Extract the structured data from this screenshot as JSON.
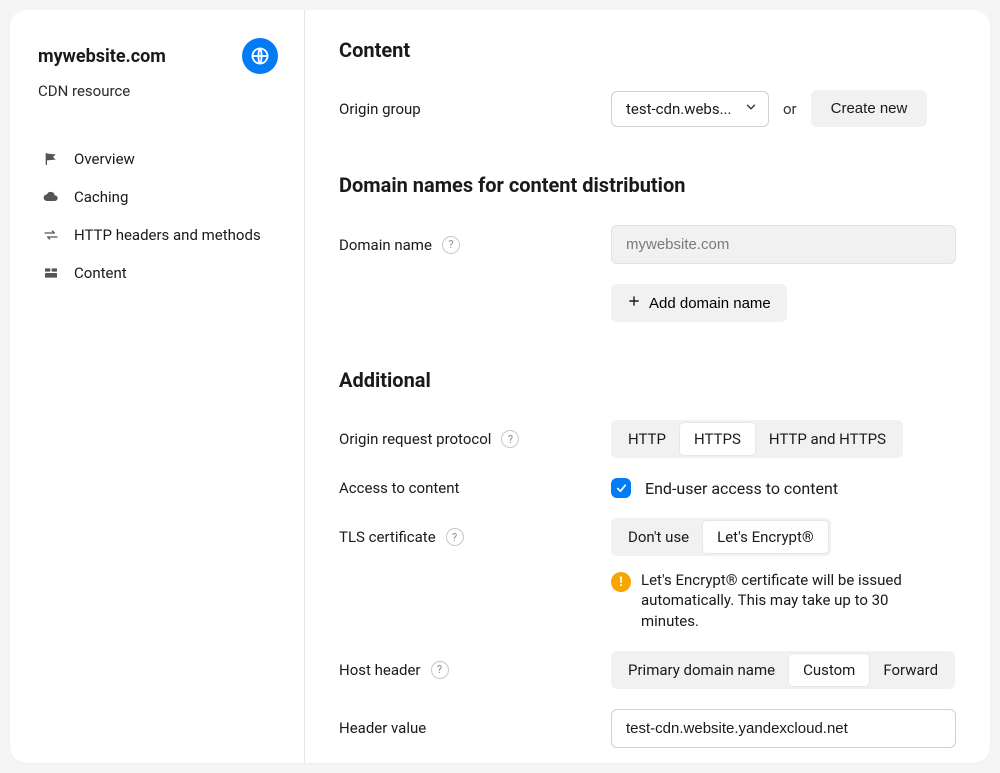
{
  "sidebar": {
    "title": "mywebsite.com",
    "subtitle": "CDN resource",
    "items": [
      {
        "label": "Overview",
        "icon": "flag"
      },
      {
        "label": "Caching",
        "icon": "cloud"
      },
      {
        "label": "HTTP headers and methods",
        "icon": "arrows"
      },
      {
        "label": "Content",
        "icon": "blocks"
      }
    ]
  },
  "content": {
    "heading": "Content",
    "origin_group_label": "Origin group",
    "origin_group_value": "test-cdn.webs...",
    "or_text": "or",
    "create_new": "Create new"
  },
  "domains": {
    "heading": "Domain names for content distribution",
    "domain_name_label": "Domain name",
    "domain_value": "mywebsite.com",
    "add_button": "Add domain name"
  },
  "additional": {
    "heading": "Additional",
    "protocol_label": "Origin request protocol",
    "protocol_options": [
      "HTTP",
      "HTTPS",
      "HTTP and HTTPS"
    ],
    "protocol_selected": "HTTPS",
    "access_label": "Access to content",
    "access_checkbox_label": "End-user access to content",
    "tls_label": "TLS certificate",
    "tls_options": [
      "Don't use",
      "Let's Encrypt®"
    ],
    "tls_selected": "Let's Encrypt®",
    "tls_note": "Let's Encrypt® certificate will be issued automatically. This may take up to 30 minutes.",
    "host_header_label": "Host header",
    "host_header_options": [
      "Primary domain name",
      "Custom",
      "Forward"
    ],
    "host_header_selected": "Custom",
    "header_value_label": "Header value",
    "header_value": "test-cdn.website.yandexcloud.net"
  }
}
